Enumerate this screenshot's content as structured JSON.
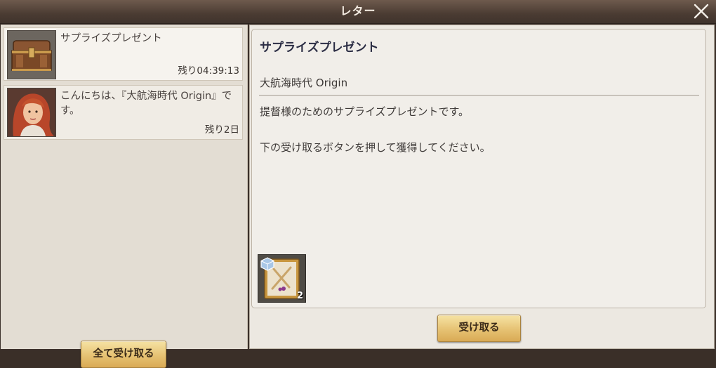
{
  "window": {
    "title": "レター"
  },
  "mail_list": [
    {
      "subject": "サプライズプレゼント",
      "remaining": "残り04:39:13",
      "thumbnail": "treasure-chest-icon",
      "selected": true
    },
    {
      "subject": "こんにちは、『大航海時代 Origin』です。",
      "remaining": "残り2日",
      "thumbnail": "character-portrait",
      "selected": false
    }
  ],
  "buttons": {
    "claim_all": "全て受け取る",
    "claim": "受け取る"
  },
  "mail_detail": {
    "title": "サプライズプレゼント",
    "sender": "大航海時代 Origin",
    "body": [
      "提督様のためのサプライズプレゼントです。",
      "下の受け取るボタンを押して獲得してください。"
    ],
    "reward": {
      "icon": "crossed-swords-scroll-icon",
      "count": "2"
    }
  },
  "colors": {
    "title_bar": "#4b3c33",
    "panel_bg": "#ece8e1",
    "button_gold": "#e6c273",
    "title_text": "#2b2d44"
  }
}
